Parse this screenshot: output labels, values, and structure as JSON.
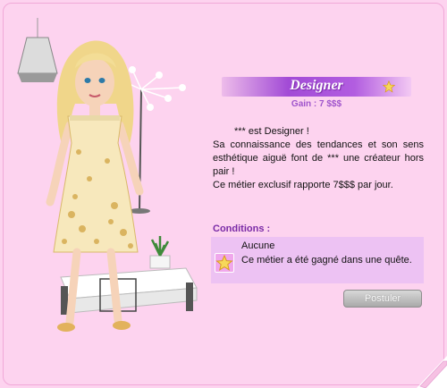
{
  "job": {
    "title": "Designer",
    "gain": "Gain : 7 $$$",
    "description": {
      "line1": "*** est Designer !",
      "line2": "Sa connaissance des tendances et son sens esthétique aiguë font de   ***  une créateur hors pair !",
      "line3": "Ce métier exclusif rapporte 7$$$ par jour."
    }
  },
  "conditions": {
    "label": "Conditions :",
    "title": "Aucune",
    "text": "Ce métier a été gagné dans une quête."
  },
  "actions": {
    "apply_label": "Postuler"
  },
  "icons": {
    "banner": "star-icon",
    "condition": "star-icon",
    "corner": "page-curl-icon"
  },
  "colors": {
    "background": "#fdd3ef",
    "banner": "#a24bd6",
    "accent_text": "#7a2aa6",
    "conditions_box": "#edc2f3",
    "button": "#b5b5b5"
  }
}
